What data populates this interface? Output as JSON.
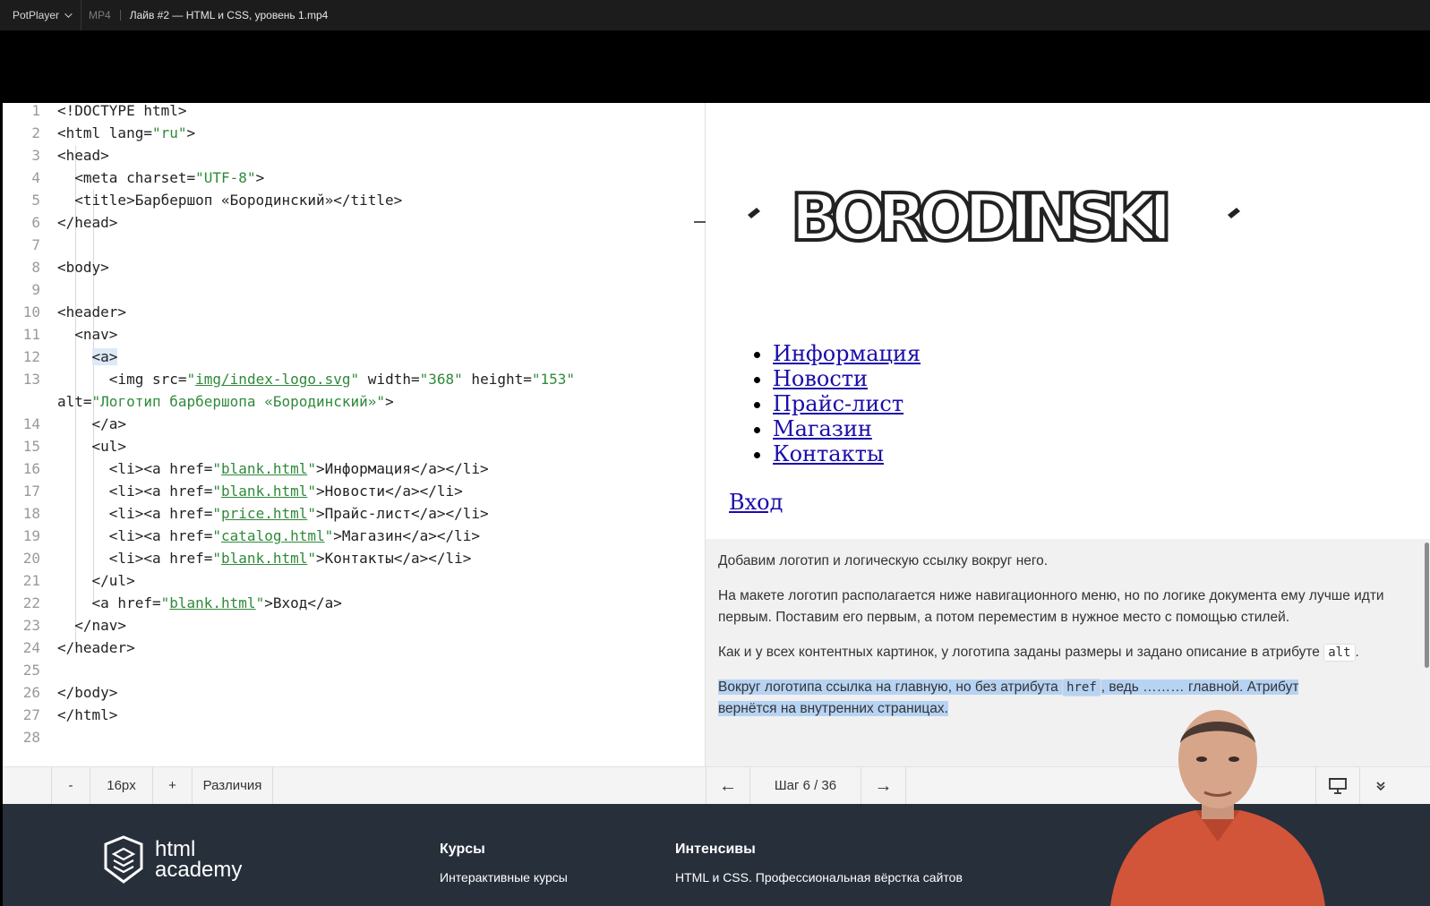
{
  "titlebar": {
    "app_name": "PotPlayer",
    "format": "MP4",
    "file_name": "Лайв #2 — HTML и CSS, уровень 1.mp4"
  },
  "editor": {
    "lines": [
      {
        "n": "1",
        "t": "<!DOCTYPE html>"
      },
      {
        "n": "2",
        "t": "<html lang=\"ru\">"
      },
      {
        "n": "3",
        "t": "<head>"
      },
      {
        "n": "4",
        "t": "  <meta charset=\"UTF-8\">"
      },
      {
        "n": "5",
        "t": "  <title>Барбершоп «Бородинский»</title>"
      },
      {
        "n": "6",
        "t": "</head>"
      },
      {
        "n": "7",
        "t": ""
      },
      {
        "n": "8",
        "t": "<body>"
      },
      {
        "n": "9",
        "t": ""
      },
      {
        "n": "10",
        "t": "<header>"
      },
      {
        "n": "11",
        "t": "  <nav>"
      },
      {
        "n": "12",
        "t": "    <a>"
      },
      {
        "n": "13",
        "t": "      <img src=\"img/index-logo.svg\" width=\"368\" height=\"153\""
      },
      {
        "n": "",
        "t": "alt=\"Логотип барбершопа «Бородинский»\">"
      },
      {
        "n": "14",
        "t": "    </a>"
      },
      {
        "n": "15",
        "t": "    <ul>"
      },
      {
        "n": "16",
        "t": "      <li><a href=\"blank.html\">Информация</a></li>"
      },
      {
        "n": "17",
        "t": "      <li><a href=\"blank.html\">Новости</a></li>"
      },
      {
        "n": "18",
        "t": "      <li><a href=\"price.html\">Прайс-лист</a></li>"
      },
      {
        "n": "19",
        "t": "      <li><a href=\"catalog.html\">Магазин</a></li>"
      },
      {
        "n": "20",
        "t": "      <li><a href=\"blank.html\">Контакты</a></li>"
      },
      {
        "n": "21",
        "t": "    </ul>"
      },
      {
        "n": "22",
        "t": "    <a href=\"blank.html\">Вход</a>"
      },
      {
        "n": "23",
        "t": "  </nav>"
      },
      {
        "n": "24",
        "t": "</header>"
      },
      {
        "n": "25",
        "t": ""
      },
      {
        "n": "26",
        "t": "</body>"
      },
      {
        "n": "27",
        "t": "</html>"
      },
      {
        "n": "28",
        "t": ""
      }
    ]
  },
  "preview": {
    "logo_text": "BORODINSKI",
    "nav_items": [
      "Информация",
      "Новости",
      "Прайс-лист",
      "Магазин",
      "Контакты"
    ],
    "login": "Вход"
  },
  "instructions": {
    "p1": "Добавим логотип и логическую ссылку вокруг него.",
    "p2": "На макете логотип располагается ниже навигационного меню, но по логике документа ему лучше идти первым. Поставим его первым, а потом переместим в нужное место с помощью стилей.",
    "p3_before": "Как и у всех контентных картинок, у логотипа заданы размеры и задано описание в атрибуте",
    "p3_code": "alt",
    "p3_after": ".",
    "p4_before": "Вокруг логотипа ссылка на главную, но без атрибута",
    "p4_code": "href",
    "p4_after": ", ведь",
    "p4_end": "главной. Атрибут",
    "p4_line2": "вернётся на внутренних страницах."
  },
  "controls": {
    "minus": "-",
    "font_size": "16px",
    "plus": "+",
    "diff": "Различия",
    "prev_arrow": "←",
    "step": "Шаг 6 / 36",
    "next_arrow": "→"
  },
  "footer": {
    "logo_line1": "html",
    "logo_line2": "academy",
    "col1_title": "Курсы",
    "col1_item": "Интерактивные курсы",
    "col2_title": "Интенсивы",
    "col2_item": "HTML и CSS. Профессиональная вёрстка сайтов"
  },
  "colors": {
    "string": "#2f8a3a",
    "link": "#1a0dab",
    "footer_bg": "#272f3b",
    "selection": "#b7d3f3"
  }
}
